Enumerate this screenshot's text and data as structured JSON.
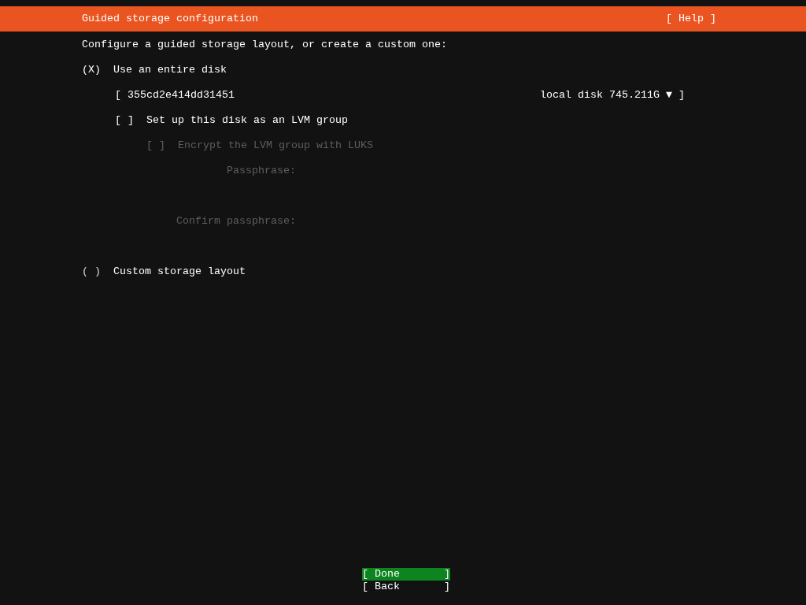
{
  "header": {
    "title": "Guided storage configuration",
    "help": "[ Help ]"
  },
  "intro": "Configure a guided storage layout, or create a custom one:",
  "entire_disk": {
    "marker": "(X)",
    "label": "Use an entire disk",
    "selected": true
  },
  "disk_select": {
    "open_bracket": "[",
    "value": "355cd2e414dd31451",
    "detail": "local disk 745.211G",
    "arrow": "▼",
    "close_bracket": "]"
  },
  "lvm": {
    "box": "[ ]",
    "label": "Set up this disk as an LVM group",
    "checked": false,
    "disabled": false
  },
  "luks": {
    "box": "[ ]",
    "label": "Encrypt the LVM group with LUKS",
    "checked": false,
    "disabled": true
  },
  "passphrase_fields": [
    {
      "label": "Passphrase:",
      "disabled": true
    },
    {
      "label": "Confirm passphrase:",
      "disabled": true
    }
  ],
  "custom_layout": {
    "marker": "( )",
    "label": "Custom storage layout",
    "selected": false
  },
  "buttons": [
    {
      "text": "[ Done       ]",
      "selected": true
    },
    {
      "text": "[ Back       ]",
      "selected": false
    }
  ]
}
